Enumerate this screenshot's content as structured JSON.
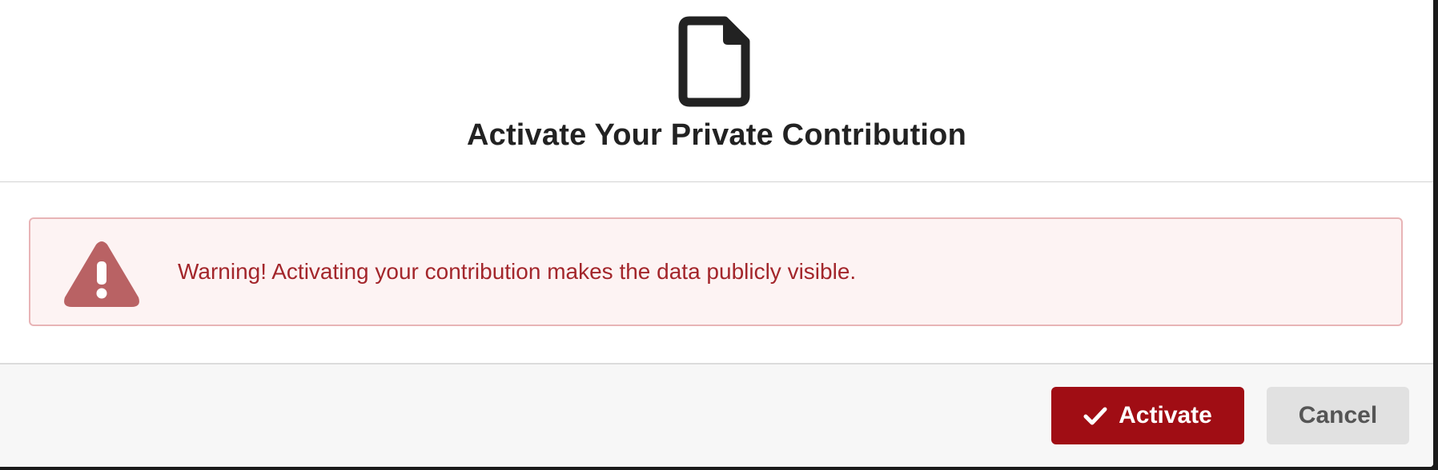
{
  "dialog": {
    "title": "Activate Your Private Contribution",
    "header_icon": "file-icon"
  },
  "alert": {
    "icon": "warning-triangle-icon",
    "message": "Warning! Activating your contribution makes the data publicly visible.",
    "text_color": "#a3262b",
    "background_color": "#fdf3f3",
    "border_color": "#e8b4b6"
  },
  "footer": {
    "activate_label": "Activate",
    "activate_icon": "check-icon",
    "activate_color": "#a00d14",
    "cancel_label": "Cancel",
    "cancel_color": "#e1e1e1"
  }
}
